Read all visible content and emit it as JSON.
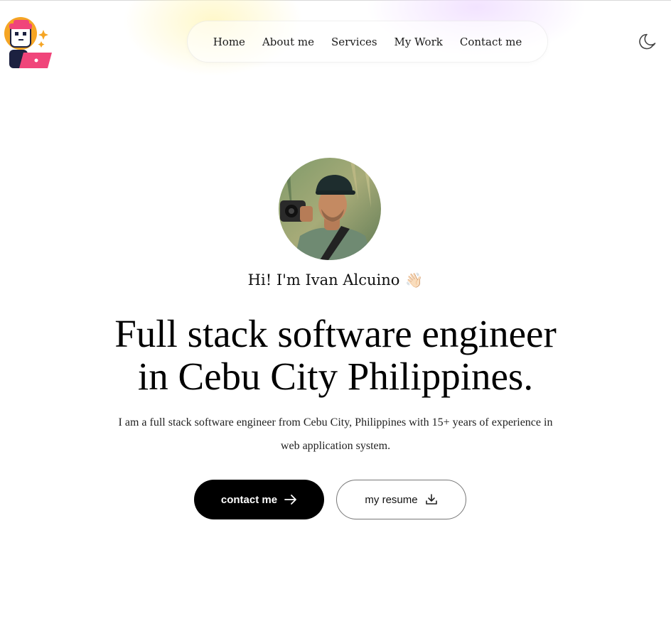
{
  "header": {
    "logo_icon": "developer-avatar-logo-icon",
    "nav": [
      {
        "label": "Home"
      },
      {
        "label": "About me"
      },
      {
        "label": "Services"
      },
      {
        "label": "My Work"
      },
      {
        "label": "Contact me"
      }
    ],
    "theme_toggle_icon": "moon-icon"
  },
  "hero": {
    "avatar_icon": "profile-photo",
    "greeting": "Hi! I'm Ivan Alcuino",
    "greeting_emoji": "👋🏻",
    "headline_line1": "Full stack software engineer",
    "headline_line2": "in Cebu City Philippines.",
    "intro_line1": "I am a full stack software engineer from Cebu City, Philippines with 15+ years of experience in",
    "intro_line2": "web application system.",
    "contact_button": "contact me",
    "resume_button": "my resume"
  },
  "colors": {
    "primary_button_bg": "#000000",
    "primary_button_text": "#ffffff",
    "logo_pink": "#f0457a",
    "logo_navy": "#1c2140",
    "logo_orange": "#f5a524"
  }
}
